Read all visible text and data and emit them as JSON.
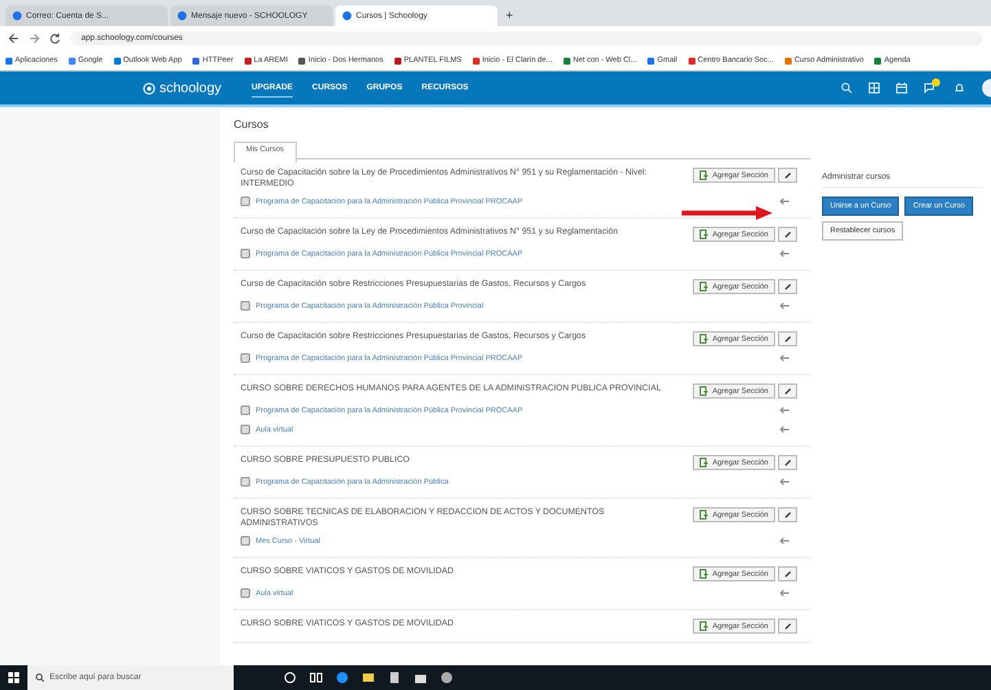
{
  "browser": {
    "tabs": [
      {
        "title": "Correo: Cuenta de S...",
        "selected": false
      },
      {
        "title": "Mensaje nuevo - SCHOOLOGY",
        "selected": false
      },
      {
        "title": "Cursos | Schoology",
        "selected": true
      }
    ],
    "new_tab": "+",
    "address": "app.schoology.com/courses",
    "bookmarks": [
      "Aplicaciones",
      "Google",
      "Outlook Web App",
      "HTTPeer",
      "La AREMI",
      "Inicio - Dos Hermanos",
      "PLANTEL FILMS",
      "Inicio - El Clarín de...",
      "Net con - Web Cl...",
      "Gmail",
      "Centro Bancario Soc...",
      "Curso Administrativo",
      "Agenda"
    ]
  },
  "nav": {
    "logo": "schoology",
    "items": [
      {
        "label": "UPGRADE",
        "selected": true
      },
      {
        "label": "CURSOS",
        "selected": false
      },
      {
        "label": "GRUPOS",
        "selected": false
      },
      {
        "label": "RECURSOS",
        "selected": false
      }
    ]
  },
  "page": {
    "title": "Cursos",
    "tabs": [
      {
        "label": "Mis Cursos",
        "selected": true
      }
    ],
    "courses": [
      {
        "title": "Curso de Capacitación sobre la Ley de Procedimientos Administrativos N° 951 y su Reglamentación - Nivel: INTERMEDIO",
        "button": "Agregar Sección",
        "sections": [
          "Programa de Capacitación para la Administración Pública Provincial PROCAAP"
        ]
      },
      {
        "title": "Curso de Capacitación sobre la Ley de Procedimientos Administrativos N° 951 y su Reglamentación",
        "button": "Agregar Sección",
        "sections": [
          "Programa de Capacitación para la Administración Pública Provincial PROCAAP"
        ]
      },
      {
        "title": "Curso de Capacitación sobre Restricciones Presupuestarias de Gastos, Recursos y Cargos",
        "button": "Agregar Sección",
        "sections": [
          "Programa de Capacitación para la Administración Pública Provincial"
        ]
      },
      {
        "title": "Curso de Capacitación sobre Restricciones Presupuestarias de Gastos, Recursos y Cargos",
        "button": "Agregar Sección",
        "sections": [
          "Programa de Capacitación para la Administración Pública Provincial PROCAAP"
        ]
      },
      {
        "title": "CURSO SOBRE DERECHOS HUMANOS PARA AGENTES DE LA ADMINISTRACION PUBLICA PROVINCIAL",
        "button": "Agregar Sección",
        "sections": [
          "Programa de Capacitación para la Administración Pública Provincial PROCAAP",
          "Aula virtual"
        ]
      },
      {
        "title": "CURSO SOBRE PRESUPUESTO PUBLICO",
        "button": "Agregar Sección",
        "sections": [
          "Programa de Capacitación para la Administración Pública"
        ]
      },
      {
        "title": "CURSO SOBRE TECNICAS DE ELABORACION Y REDACCION DE ACTOS Y DOCUMENTOS ADMINISTRATIVOS",
        "button": "Agregar Sección",
        "sections": [
          "Mes Curso - Virtual"
        ]
      },
      {
        "title": "CURSO SOBRE VIATICOS Y GASTOS DE MOVILIDAD",
        "button": "Agregar Sección",
        "sections": [
          "Aula virtual"
        ]
      },
      {
        "title": "CURSO SOBRE VIATICOS Y GASTOS DE MOVILIDAD",
        "button": "Agregar Sección"
      }
    ]
  },
  "admin": {
    "title": "Administrar cursos",
    "buttons": [
      {
        "label": "Unirse a un Curso",
        "kind": "primary"
      },
      {
        "label": "Crear un Curso",
        "kind": "primary"
      },
      {
        "label": "Restablecer cursos",
        "kind": "secondary"
      }
    ]
  },
  "taskbar": {
    "search_placeholder": "Escribe aquí para buscar"
  }
}
